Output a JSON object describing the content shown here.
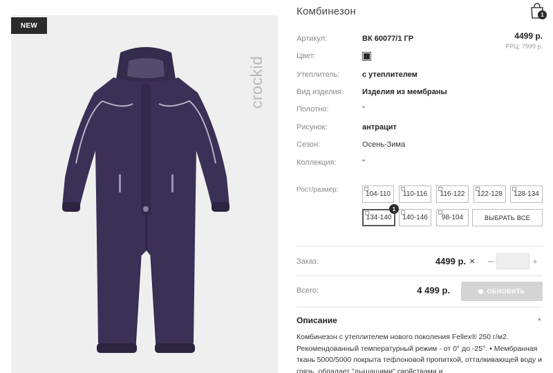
{
  "badge": {
    "new_label": "NEW"
  },
  "brand": {
    "logo_text": "crockid"
  },
  "product": {
    "title": "Комбинезон",
    "price": "4499 р.",
    "rrp": "РРЦ: 7999 р."
  },
  "cart": {
    "count": "1"
  },
  "details": [
    {
      "label": "Артикул:",
      "value": "ВК 60077/1 ГР",
      "bold": true
    },
    {
      "label": "Цвет:",
      "value": "",
      "bold": false
    },
    {
      "label": "Утеплитель:",
      "value": "с утеплителем",
      "bold": true
    },
    {
      "label": "Вид изделия:",
      "value": "Изделия из мембраны",
      "bold": true
    },
    {
      "label": "Полотно:",
      "value": "\"",
      "bold": false
    },
    {
      "label": "Рисунок:",
      "value": "антрацит",
      "bold": true
    },
    {
      "label": "Сезон:",
      "value": "Осень-Зима",
      "bold": false
    },
    {
      "label": "Коллекция:",
      "value": "\"",
      "bold": false
    }
  ],
  "sizes": {
    "label": "Рост/размер:",
    "options": [
      "104-110",
      "110-116",
      "116-122",
      "122-128",
      "128-134",
      "134-140",
      "140-146",
      "98-104"
    ],
    "selected": "134-140",
    "selected_count": "1",
    "select_all_label": "ВЫБРАТЬ ВСЕ"
  },
  "order": {
    "label": "Заказ:",
    "price": "4499 р.",
    "times": "×",
    "minus": "–",
    "plus": "+",
    "quantity": ""
  },
  "total": {
    "label": "Всего:",
    "value": "4 499 р.",
    "update_label": "ОБНОВИТЬ"
  },
  "description": {
    "title": "Описание",
    "text": "Комбинезон с утеплителем нового поколения Fellex® 250 г/м2. Рекомендованный температурный режим - от 0° до -25°. • Мембранная ткань 5000/5000 покрыта тефлоновой пропиткой, отталкивающей воду и грязь, обладает \"дышащими\" свойствами и"
  },
  "colors": {
    "badge_bg": "#2b2b2b",
    "garment": "#3b3055",
    "panel_bg": "#efefef",
    "button_disabled": "#d4d4d4"
  }
}
